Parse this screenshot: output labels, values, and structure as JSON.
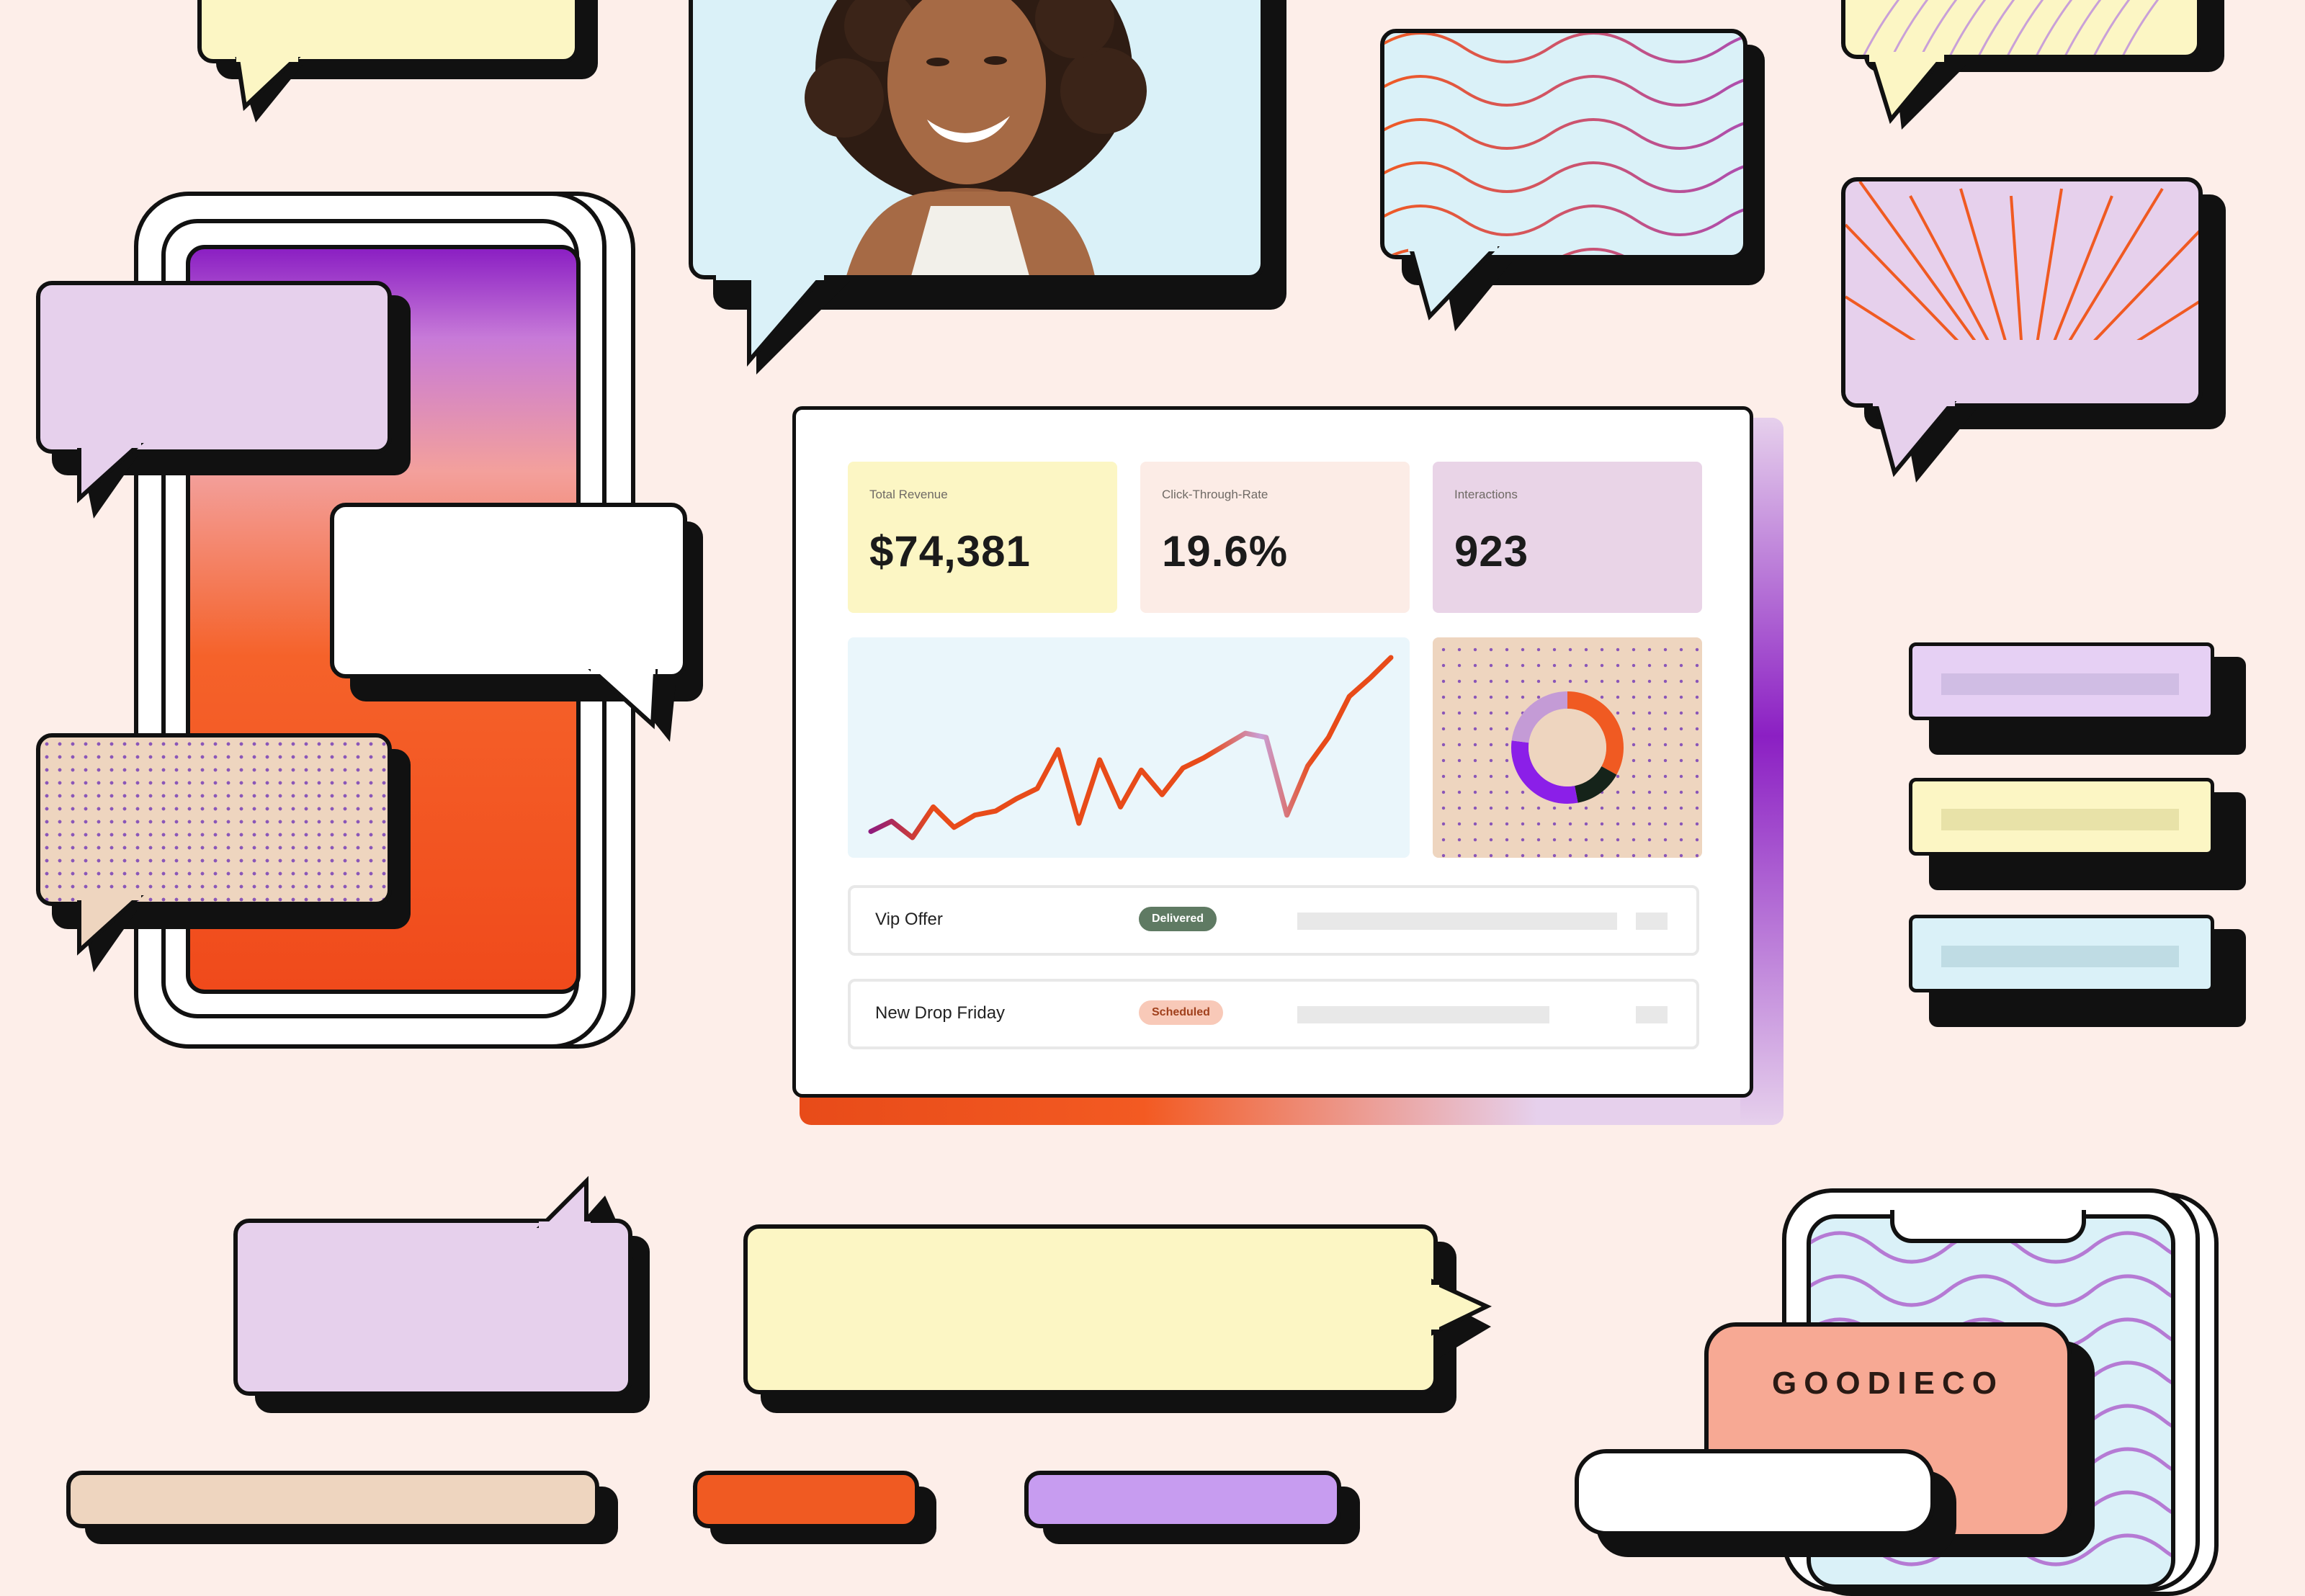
{
  "dashboard": {
    "stats": [
      {
        "label": "Total Revenue",
        "value": "$74,381",
        "color": "#fcf6c4"
      },
      {
        "label": "Click-Through-Rate",
        "value": "19.6%",
        "color": "#fcece6"
      },
      {
        "label": "Interactions",
        "value": "923",
        "color": "#e9d4e7"
      }
    ],
    "line_chart": {
      "stroke_colors": [
        "#8e1b7d",
        "#e84b19",
        "#c9a0d8"
      ],
      "values": [
        10,
        15,
        7,
        22,
        12,
        18,
        20,
        26,
        31,
        50,
        14,
        45,
        22,
        40,
        28,
        41,
        46,
        52,
        58,
        56,
        18,
        42,
        56,
        76,
        85,
        95
      ]
    },
    "donut": {
      "segments": [
        {
          "share": 0.33,
          "color": "#f05a22"
        },
        {
          "share": 0.14,
          "color": "#15231a"
        },
        {
          "share": 0.3,
          "color": "#8b1fe8"
        },
        {
          "share": 0.23,
          "color": "#c49bd6"
        }
      ]
    },
    "rows": [
      {
        "name": "Vip Offer",
        "status": "Delivered",
        "status_color": "#5f7a63",
        "status_text_color": "#ffffff"
      },
      {
        "name": "New Drop Friday",
        "status": "Scheduled",
        "status_color": "#f8c9b8",
        "status_text_color": "#a0401c"
      }
    ]
  },
  "brand": {
    "name": "GOODIECO"
  },
  "colors": {
    "background": "#fdeee9",
    "accent_orange": "#f05a22",
    "accent_purple": "#8b1fc3"
  }
}
